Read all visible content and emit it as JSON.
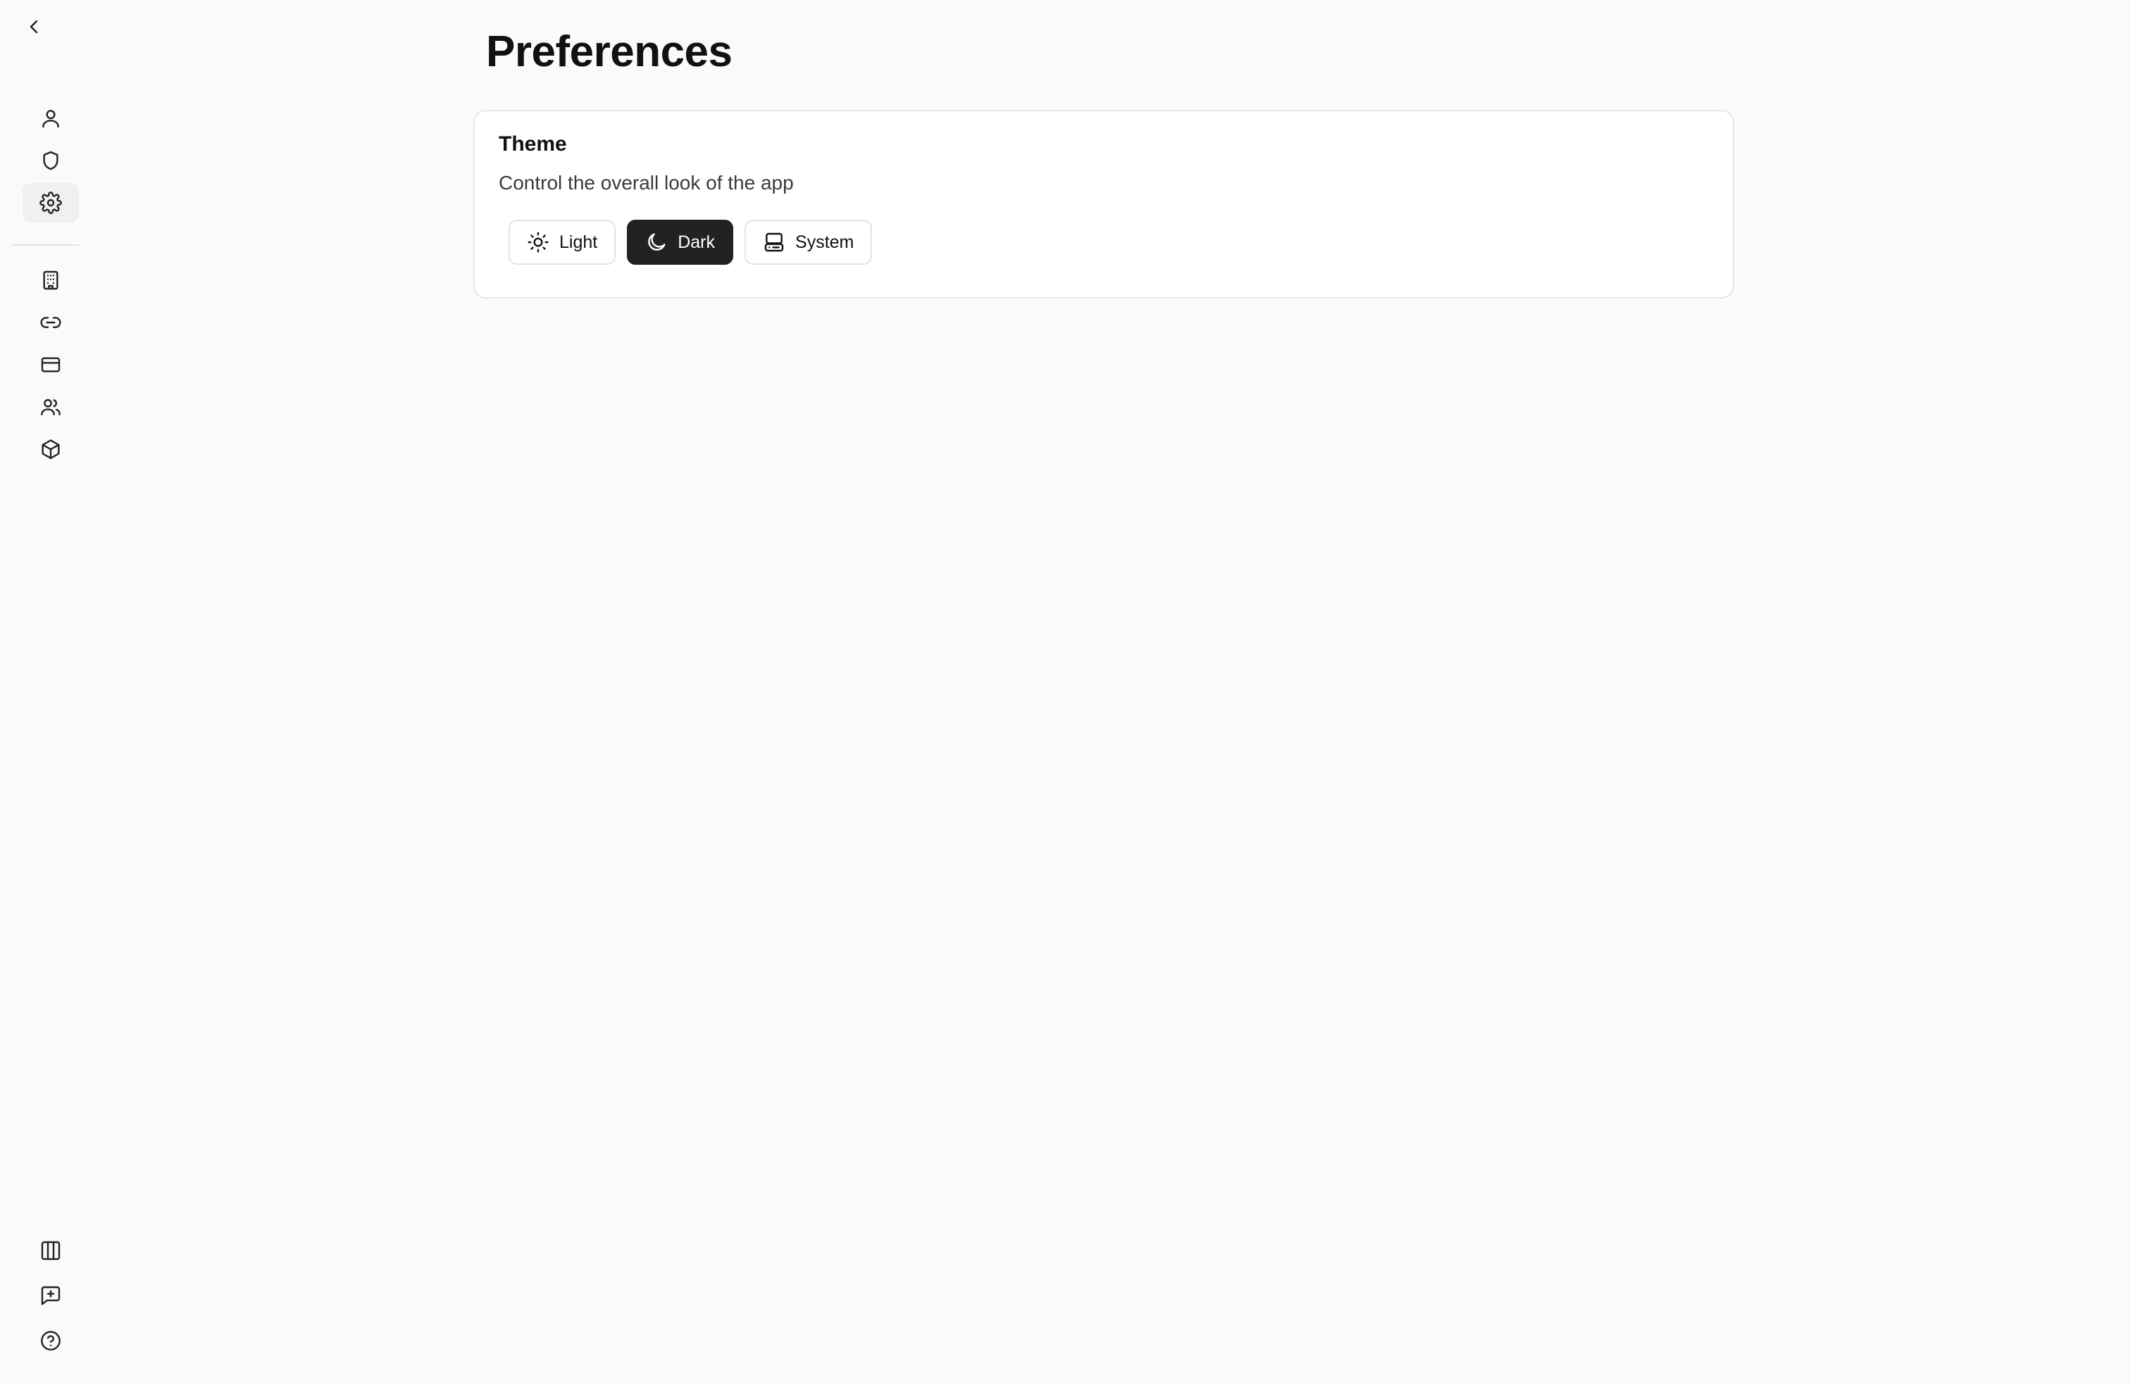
{
  "page": {
    "title": "Preferences"
  },
  "sidebar": {
    "back_icon": "chevron-left-icon",
    "top_items": [
      {
        "icon": "user-icon"
      },
      {
        "icon": "shield-icon"
      },
      {
        "icon": "gear-icon",
        "active": true
      }
    ],
    "middle_items": [
      {
        "icon": "building-icon"
      },
      {
        "icon": "link-icon"
      },
      {
        "icon": "credit-card-icon"
      },
      {
        "icon": "users-icon"
      },
      {
        "icon": "cube-icon"
      }
    ],
    "bottom_items": [
      {
        "icon": "columns-icon"
      },
      {
        "icon": "message-plus-icon"
      },
      {
        "icon": "help-circle-icon"
      }
    ]
  },
  "theme": {
    "title": "Theme",
    "description": "Control the overall look of the app",
    "options": [
      {
        "label": "Light",
        "icon": "sun-icon"
      },
      {
        "label": "Dark",
        "icon": "moon-icon"
      },
      {
        "label": "System",
        "icon": "monitor-icon"
      }
    ],
    "selected": "Dark"
  },
  "colors": {
    "background": "#fafafa",
    "card": "#ffffff",
    "border": "#e6e6e6",
    "selected_bg": "#222222",
    "active_nav_bg": "#f0f0f0"
  }
}
